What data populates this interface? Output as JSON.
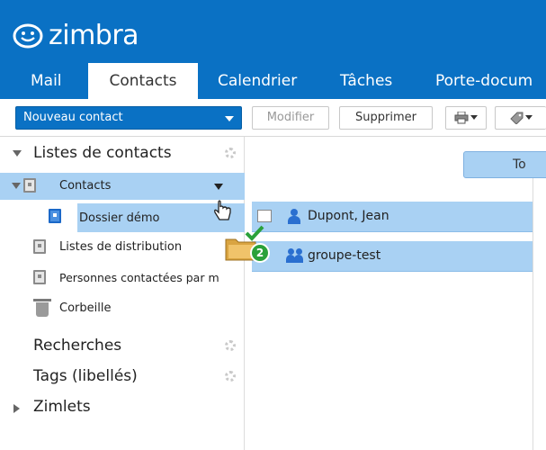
{
  "app": {
    "name": "zimbra"
  },
  "tabs": [
    {
      "label": "Mail",
      "active": false
    },
    {
      "label": "Contacts",
      "active": true
    },
    {
      "label": "Calendrier",
      "active": false
    },
    {
      "label": "Tâches",
      "active": false
    },
    {
      "label": "Porte-docum",
      "active": false
    }
  ],
  "toolbar": {
    "new_contact": "Nouveau contact",
    "edit": "Modifier",
    "delete": "Supprimer"
  },
  "sidebar": {
    "section_title": "Listes de contacts",
    "items": [
      {
        "label": "Contacts",
        "selected": true
      },
      {
        "label": "Dossier démo",
        "selected": true
      },
      {
        "label": "Listes de distribution",
        "selected": false
      },
      {
        "label": "Personnes contactées par m",
        "selected": false
      },
      {
        "label": "Corbeille",
        "selected": false
      }
    ],
    "searches": "Recherches",
    "tags": "Tags (libellés)",
    "zimlets": "Zimlets"
  },
  "main": {
    "view_button": "To",
    "contacts": [
      {
        "name": "Dupont, Jean",
        "type": "person"
      },
      {
        "name": "groupe-test",
        "type": "group"
      }
    ],
    "drag_count": "2"
  },
  "colors": {
    "brand": "#0a71c4",
    "selection": "#a9d1f3"
  }
}
